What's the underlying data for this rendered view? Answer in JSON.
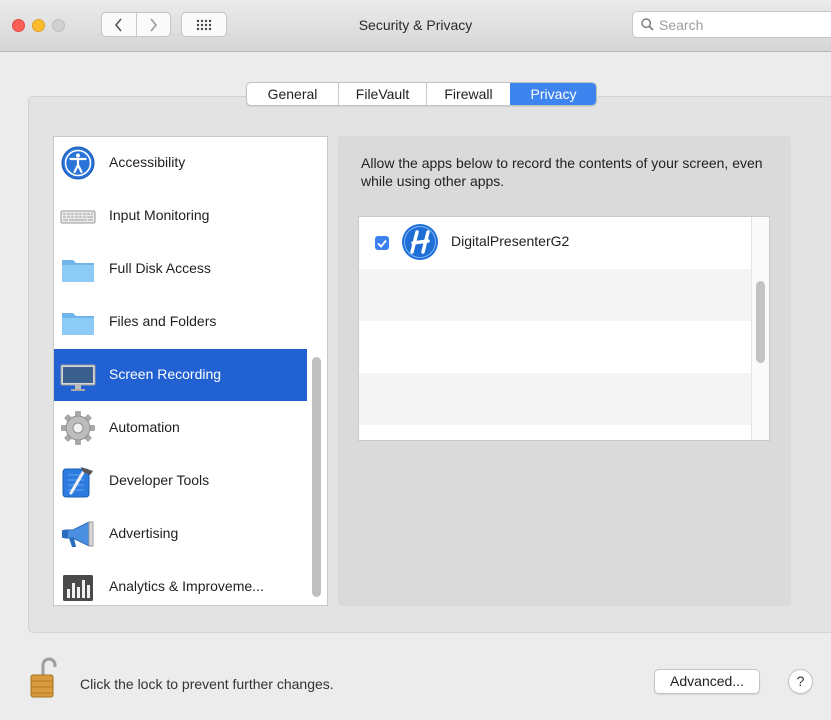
{
  "window": {
    "title": "Security & Privacy",
    "search_placeholder": "Search"
  },
  "tabs": [
    {
      "label": "General",
      "selected": false
    },
    {
      "label": "FileVault",
      "selected": false
    },
    {
      "label": "Firewall",
      "selected": false
    },
    {
      "label": "Privacy",
      "selected": true
    }
  ],
  "sidebar": {
    "items": [
      {
        "label": "Accessibility",
        "icon": "accessibility-icon"
      },
      {
        "label": "Input Monitoring",
        "icon": "keyboard-icon"
      },
      {
        "label": "Full Disk Access",
        "icon": "folder-icon"
      },
      {
        "label": "Files and Folders",
        "icon": "folder-icon"
      },
      {
        "label": "Screen Recording",
        "icon": "display-icon",
        "selected": true
      },
      {
        "label": "Automation",
        "icon": "gear-icon"
      },
      {
        "label": "Developer Tools",
        "icon": "xcode-icon"
      },
      {
        "label": "Advertising",
        "icon": "megaphone-icon"
      },
      {
        "label": "Analytics & Improveme...",
        "icon": "analytics-icon"
      }
    ]
  },
  "main": {
    "description": "Allow the apps below to record the contents of your screen, even while using other apps.",
    "apps": [
      {
        "name": "DigitalPresenterG2",
        "checked": true,
        "icon": "digitalpresenter-app-icon"
      }
    ]
  },
  "footer": {
    "lock_text": "Click the lock to prevent further changes.",
    "advanced_label": "Advanced...",
    "help_label": "?"
  },
  "colors": {
    "selection": "#2261d1",
    "tab_selected": "#3e84ee",
    "checkbox": "#3b82f0"
  }
}
